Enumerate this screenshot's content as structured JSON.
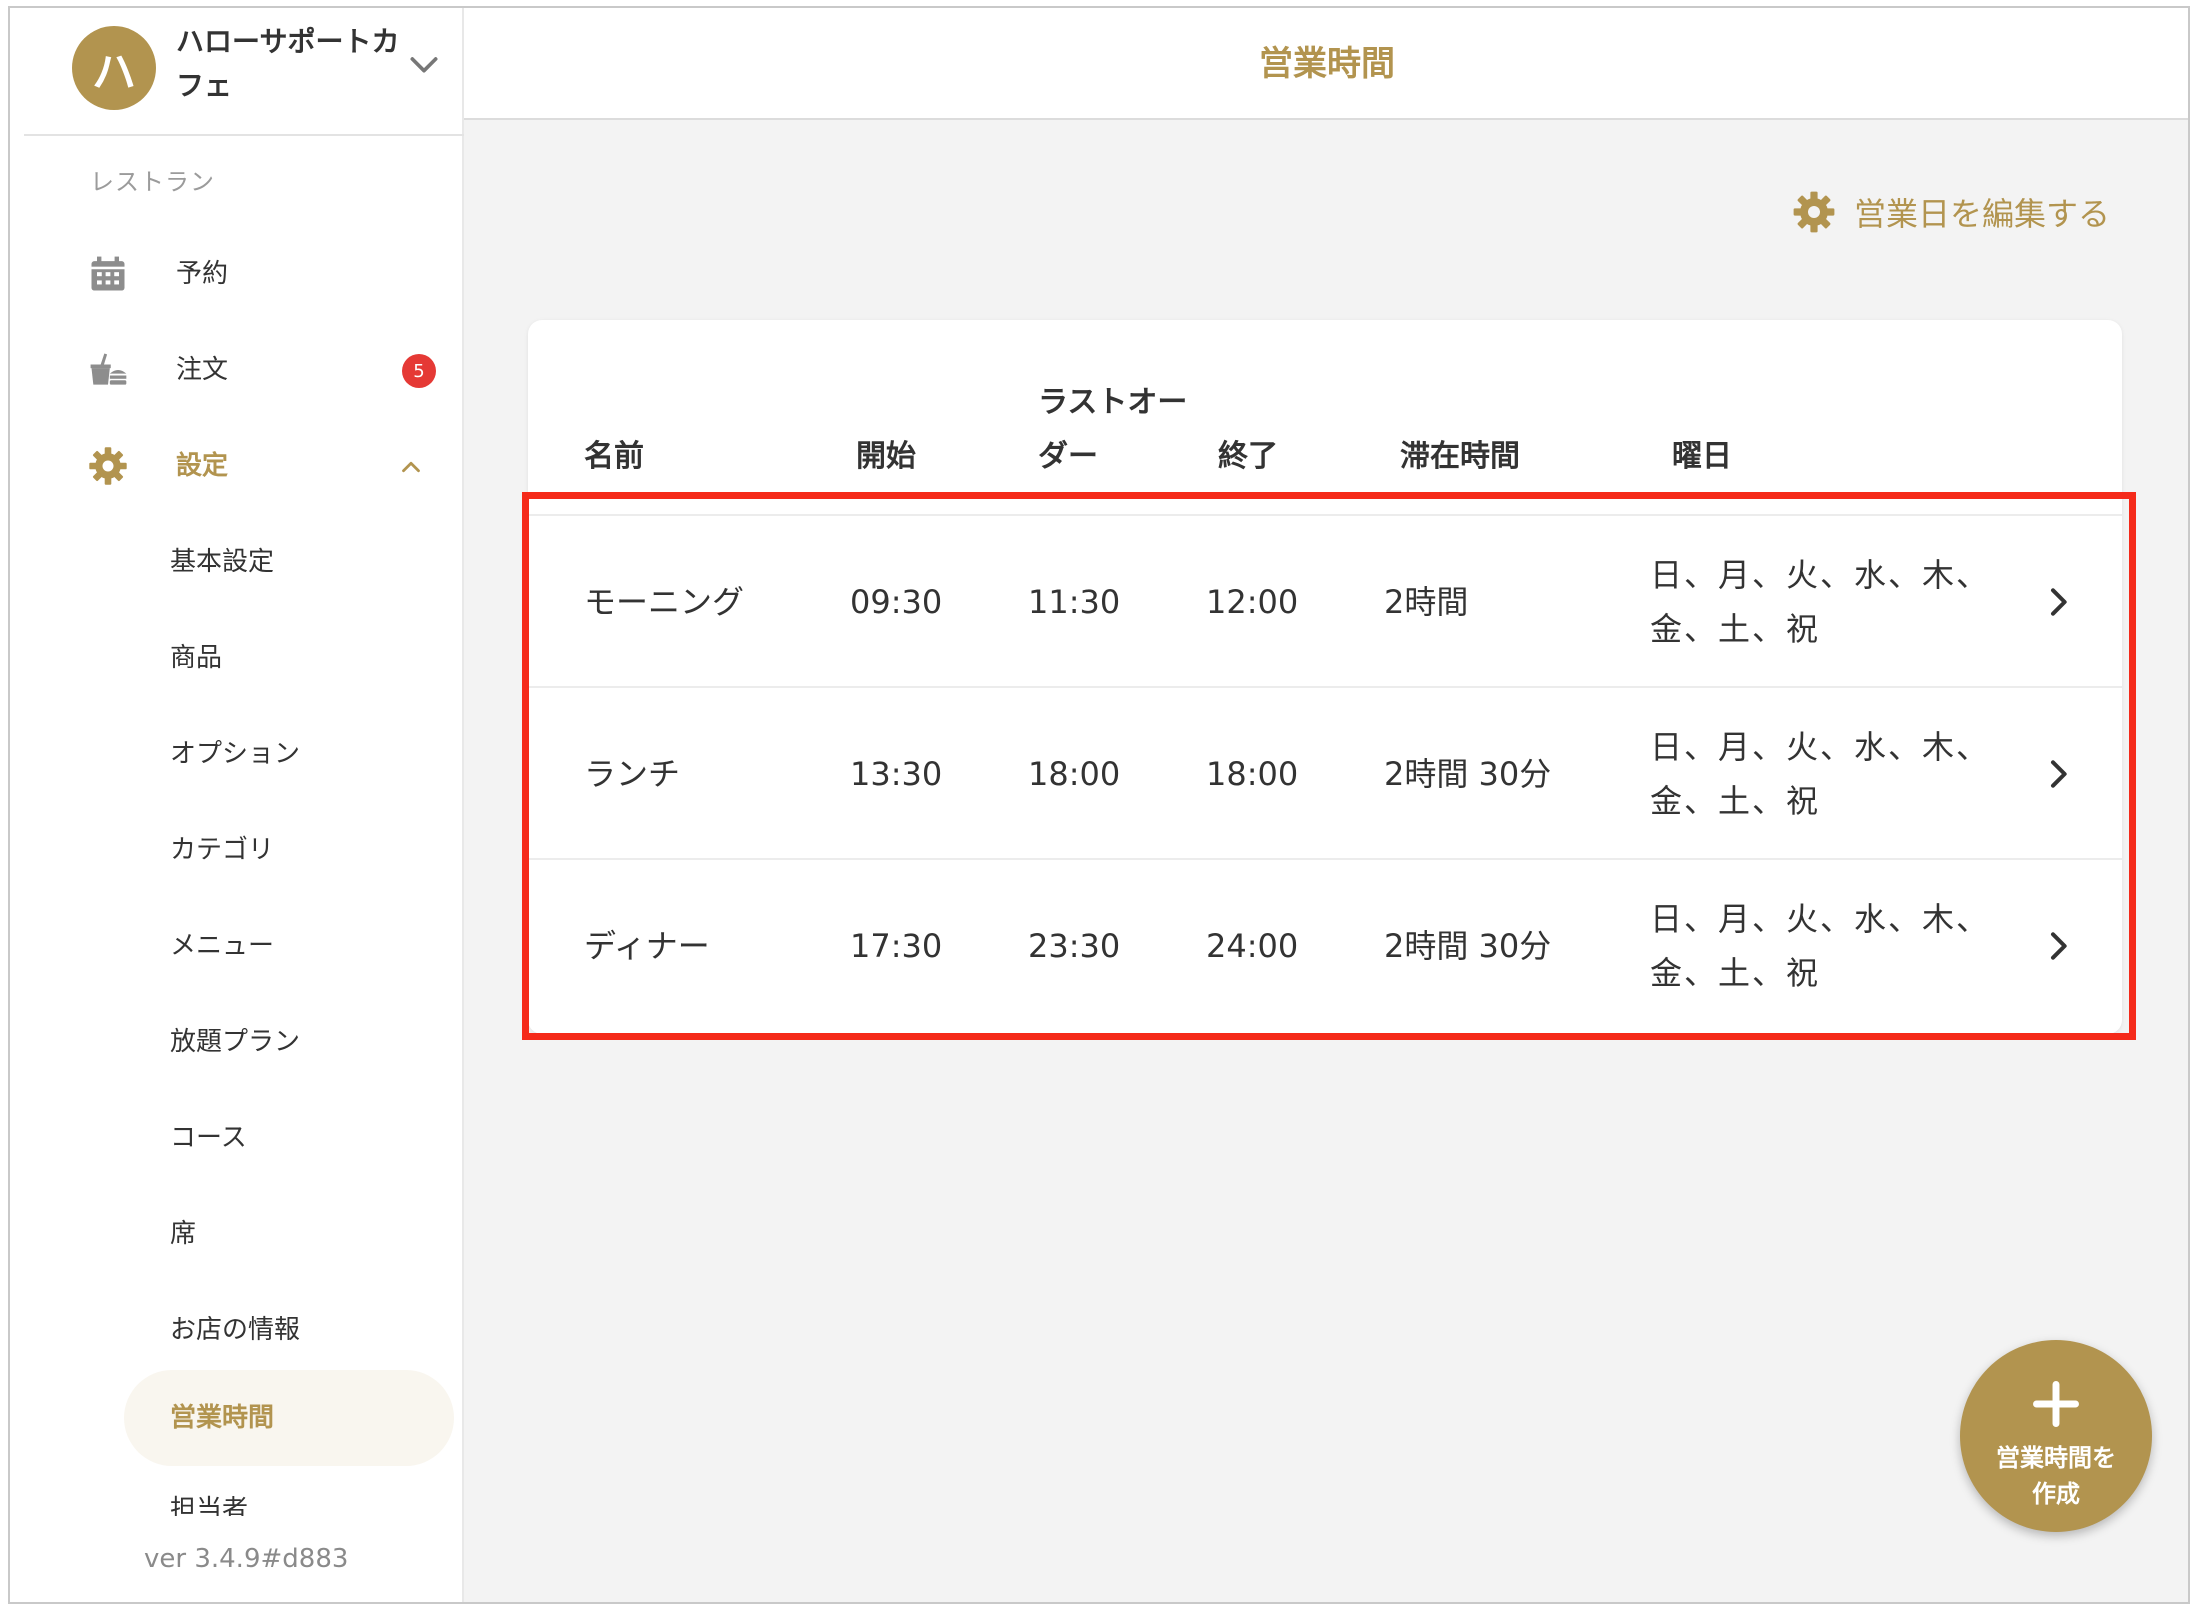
{
  "sidebar": {
    "account": {
      "initial": "ハ",
      "name": "ハローサポートカフェ"
    },
    "section_label": "レストラン",
    "nav": [
      {
        "label": "予約",
        "icon": "calendar-icon"
      },
      {
        "label": "注文",
        "icon": "food-tray-icon",
        "badge": "5"
      },
      {
        "label": "設定",
        "icon": "gear-icon"
      }
    ],
    "settings_items": [
      "基本設定",
      "商品",
      "オプション",
      "カテゴリ",
      "メニュー",
      "放題プラン",
      "コース",
      "席",
      "お店の情報",
      "営業時間",
      "担当者"
    ],
    "version": "ver 3.4.9#d883"
  },
  "header": {
    "title": "営業時間"
  },
  "main": {
    "edit_days_label": "営業日を編集する",
    "columns": {
      "name": "名前",
      "start": "開始",
      "last_order_line1": "ラストオー",
      "last_order_line2": "ダー",
      "end": "終了",
      "stay": "滞在時間",
      "days": "曜日"
    },
    "rows": [
      {
        "name": "モーニング",
        "start": "09:30",
        "last_order": "11:30",
        "end": "12:00",
        "stay": "2時間",
        "days_line1": "日、月、火、水、木、",
        "days_line2": "金、土、祝"
      },
      {
        "name": "ランチ",
        "start": "13:30",
        "last_order": "18:00",
        "end": "18:00",
        "stay": "2時間 30分",
        "days_line1": "日、月、火、水、木、",
        "days_line2": "金、土、祝"
      },
      {
        "name": "ディナー",
        "start": "17:30",
        "last_order": "23:30",
        "end": "24:00",
        "stay": "2時間 30分",
        "days_line1": "日、月、火、水、木、",
        "days_line2": "金、土、祝"
      }
    ],
    "fab_label_line1": "営業時間を",
    "fab_label_line2": "作成"
  },
  "colors": {
    "accent": "#b2944f",
    "badge": "#e53935",
    "highlight": "#f52a1a"
  }
}
